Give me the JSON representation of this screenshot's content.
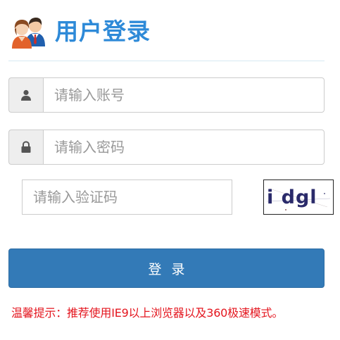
{
  "header": {
    "title": "用户登录",
    "icon": "users-icon"
  },
  "form": {
    "username": {
      "placeholder": "请输入账号",
      "value": "",
      "icon": "user-icon"
    },
    "password": {
      "placeholder": "请输入密码",
      "value": "",
      "icon": "lock-icon"
    },
    "captcha": {
      "placeholder": "请输入验证码",
      "value": "",
      "image_text": "i dgl"
    },
    "submit_label": "登录"
  },
  "notice": "温馨提示：推荐使用IE9以上浏览器以及360极速模式。",
  "colors": {
    "title": "#2e8ad8",
    "button": "#337ab7",
    "notice": "#e4151e",
    "captcha_text": "#2a2a6a"
  }
}
